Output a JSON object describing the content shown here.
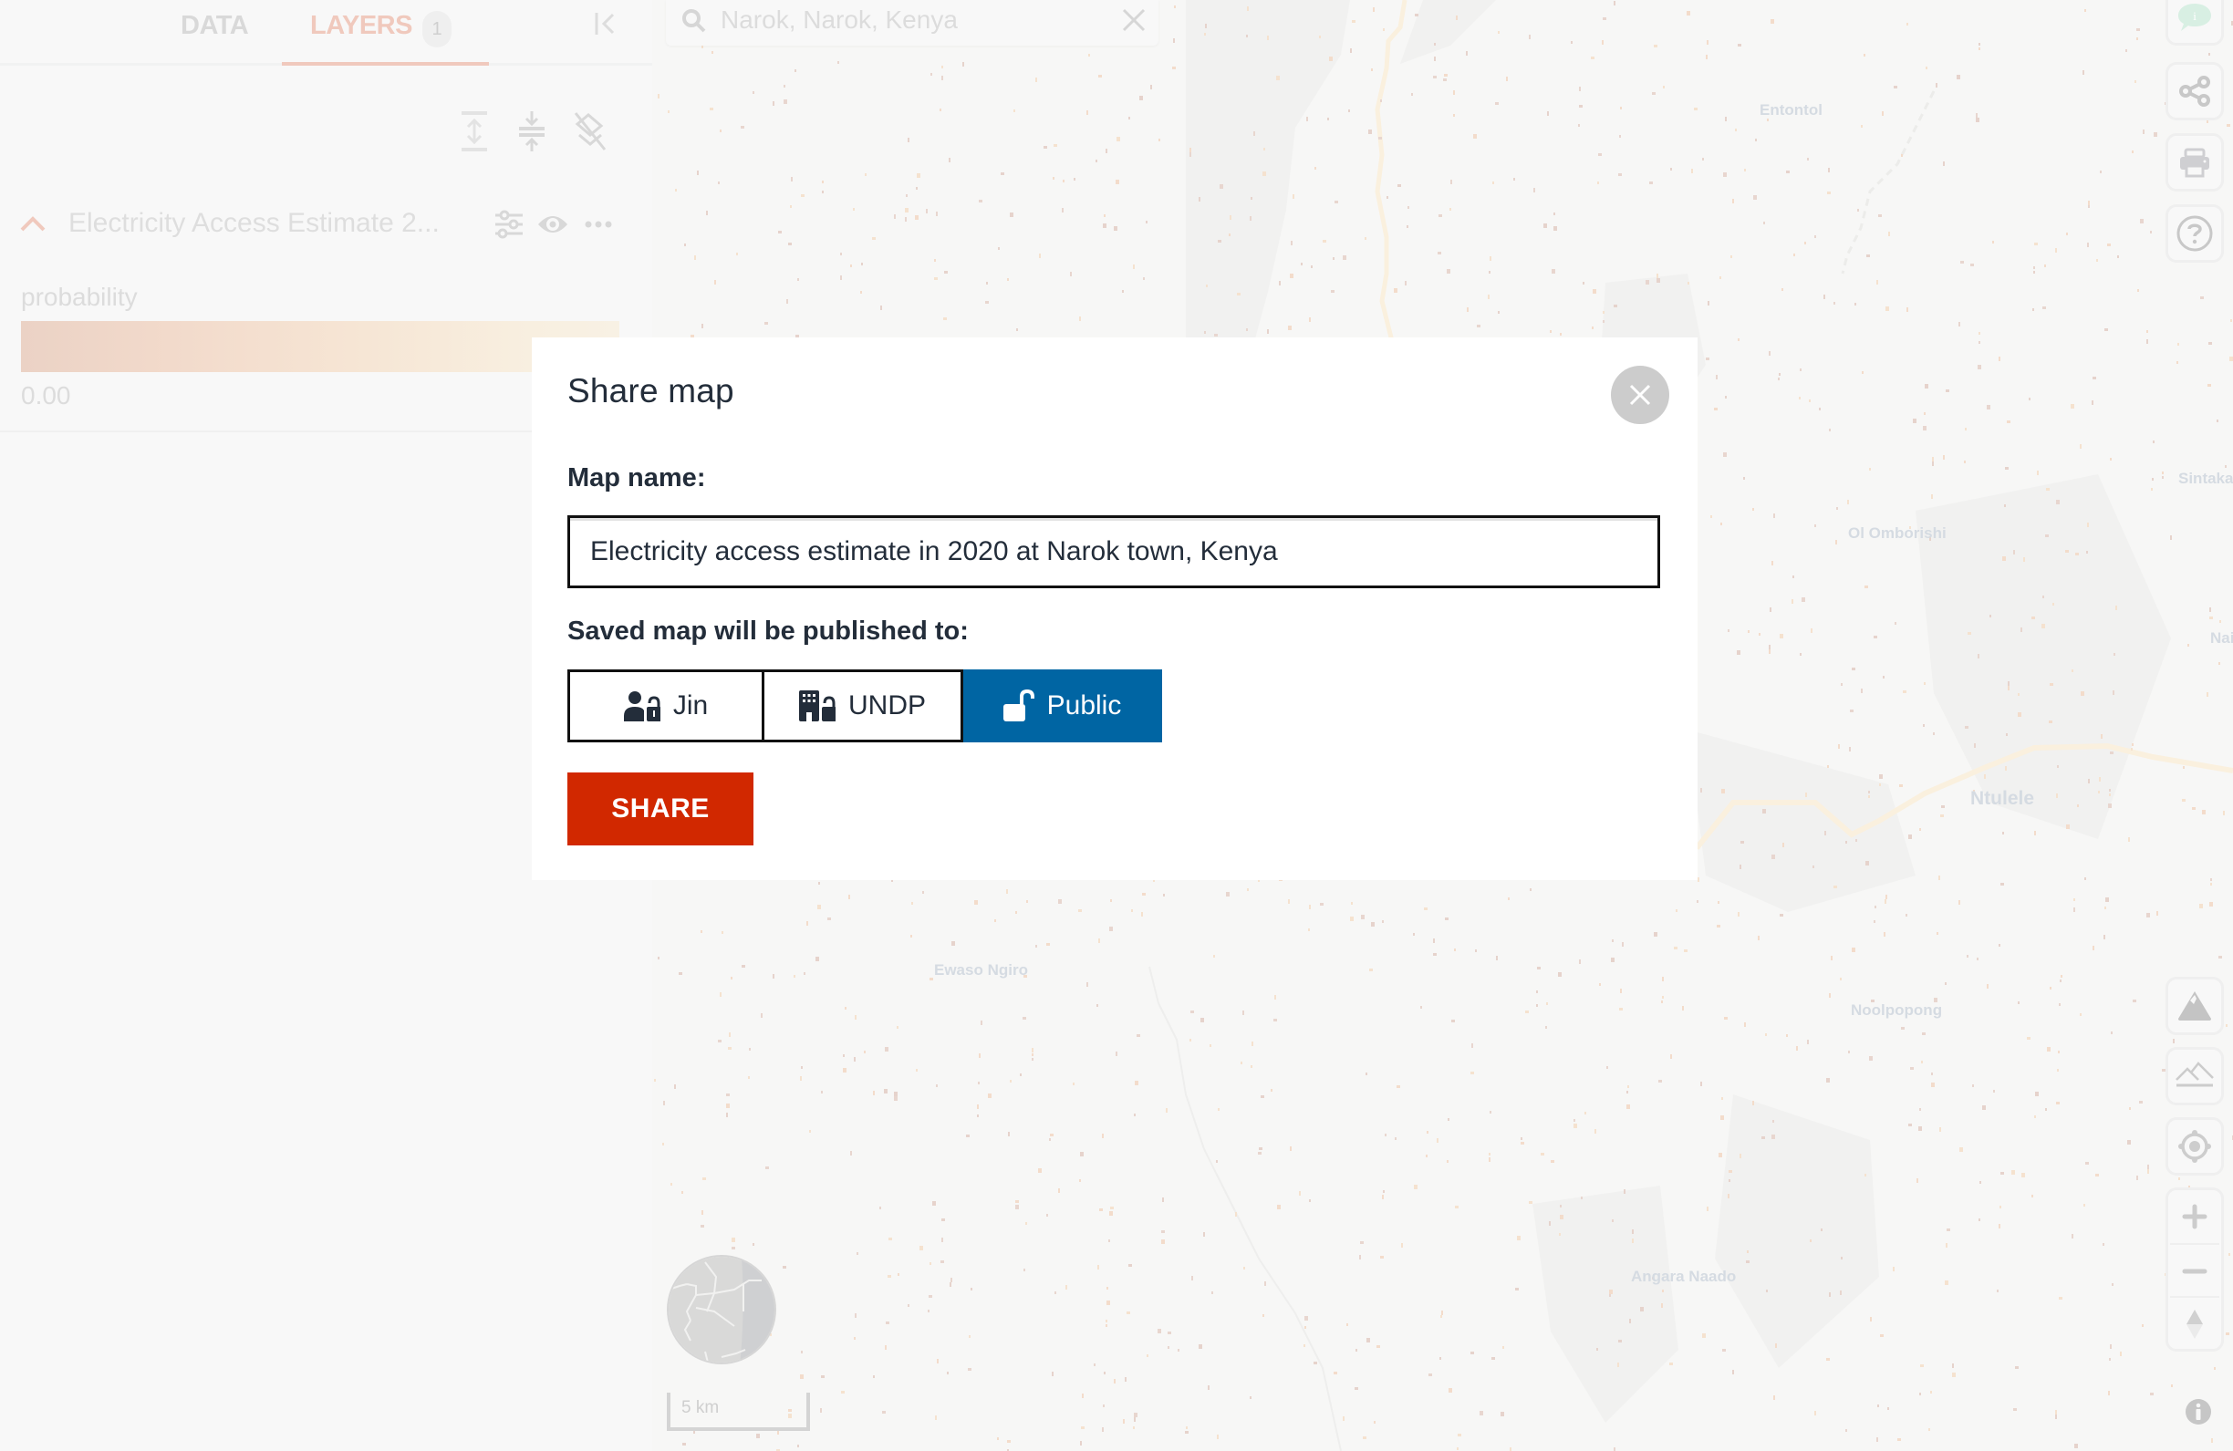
{
  "left_panel": {
    "tabs": [
      {
        "label": "DATA",
        "active": false
      },
      {
        "label": "LAYERS",
        "active": true,
        "badge": "1"
      }
    ],
    "tools": [
      "expand-all-icon",
      "collapse-all-icon",
      "hide-all-icon"
    ],
    "layer": {
      "name": "Electricity Access Estimate 2...",
      "expanded": true,
      "icons": [
        "settings-sliders-icon",
        "visibility-eye-icon",
        "more-options-icon"
      ]
    },
    "legend": {
      "title": "probability",
      "min_label": "0.00",
      "gradient_colors": [
        "#ebd2c5",
        "#f8f1e4"
      ]
    }
  },
  "search": {
    "value": "Narok, Narok, Kenya",
    "icon": "search-icon",
    "clear_icon": "close-icon"
  },
  "map": {
    "labels": [
      {
        "text": "Entontol"
      },
      {
        "text": "Sintaka"
      },
      {
        "text": "Ol Omborishi"
      },
      {
        "text": "Nai"
      },
      {
        "text": "Ntulele"
      },
      {
        "text": "Ewaso Ngiro"
      },
      {
        "text": "Noolpopong"
      },
      {
        "text": "Angara Naado"
      }
    ],
    "scale_label": "5 km"
  },
  "right_toolbar": {
    "buttons": [
      "feedback-icon",
      "share-icon",
      "print-icon",
      "help-icon",
      "terrain-icon",
      "landscape-icon",
      "locate-icon",
      "zoom-in-icon",
      "zoom-out-icon",
      "compass-icon",
      "info-icon"
    ]
  },
  "modal": {
    "title": "Share map",
    "map_name_label": "Map name:",
    "map_name_value": "Electricity access estimate in 2020 at Narok town, Kenya",
    "publish_label": "Saved map will be published to:",
    "options": [
      {
        "label": "Jin",
        "icon": "user-lock-icon",
        "selected": false
      },
      {
        "label": "UNDP",
        "icon": "building-lock-icon",
        "selected": false
      },
      {
        "label": "Public",
        "icon": "unlock-icon",
        "selected": true
      }
    ],
    "share_button": "SHARE",
    "colors": {
      "selected": "#0065a3",
      "share": "#d12800"
    }
  }
}
